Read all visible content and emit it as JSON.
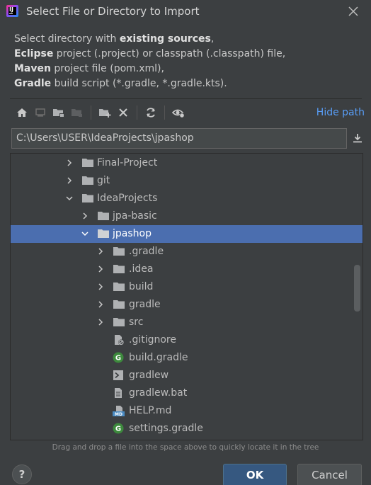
{
  "window": {
    "title": "Select File or Directory to Import"
  },
  "description": {
    "line1_pre": "Select directory with ",
    "line1_bold": "existing sources",
    "line1_post": ",",
    "line2_bold": "Eclipse",
    "line2_post": " project (.project) or classpath (.classpath) file,",
    "line3_bold": "Maven",
    "line3_post": " project file (pom.xml),",
    "line4_bold": "Gradle",
    "line4_post": " build script (*.gradle, *.gradle.kts)."
  },
  "toolbar": {
    "hide_path_label": "Hide path",
    "icons": [
      "home-icon",
      "desktop-icon",
      "new-folder-icon",
      "project-folder-icon",
      "new-folder-add-icon",
      "delete-icon",
      "refresh-icon",
      "show-hidden-icon"
    ]
  },
  "path": {
    "value": "C:\\Users\\USER\\IdeaProjects\\jpashop"
  },
  "tree": {
    "items": [
      {
        "label": "Final-Project",
        "kind": "folder",
        "expander": "collapsed"
      },
      {
        "label": "git",
        "kind": "folder",
        "expander": "collapsed"
      },
      {
        "label": "IdeaProjects",
        "kind": "folder",
        "expander": "expanded"
      },
      {
        "label": "jpa-basic",
        "kind": "folder",
        "expander": "collapsed"
      },
      {
        "label": "jpashop",
        "kind": "folder",
        "expander": "expanded",
        "selected": true
      },
      {
        "label": ".gradle",
        "kind": "folder",
        "expander": "collapsed"
      },
      {
        "label": ".idea",
        "kind": "folder",
        "expander": "collapsed"
      },
      {
        "label": "build",
        "kind": "folder",
        "expander": "collapsed"
      },
      {
        "label": "gradle",
        "kind": "folder",
        "expander": "collapsed"
      },
      {
        "label": "src",
        "kind": "folder",
        "expander": "collapsed"
      },
      {
        "label": ".gitignore",
        "kind": "ignore-file"
      },
      {
        "label": "build.gradle",
        "kind": "gradle-file"
      },
      {
        "label": "gradlew",
        "kind": "shell-file"
      },
      {
        "label": "gradlew.bat",
        "kind": "text-file"
      },
      {
        "label": "HELP.md",
        "kind": "markdown-file",
        "badge": "MD"
      },
      {
        "label": "settings.gradle",
        "kind": "gradle-file"
      }
    ]
  },
  "hint": "Drag and drop a file into the space above to quickly locate it in the tree",
  "buttons": {
    "help": "?",
    "ok": "OK",
    "cancel": "Cancel"
  },
  "colors": {
    "selection": "#4b6eaf",
    "link": "#589df6",
    "gradle": "#3d8a3d",
    "ok": "#365880"
  }
}
